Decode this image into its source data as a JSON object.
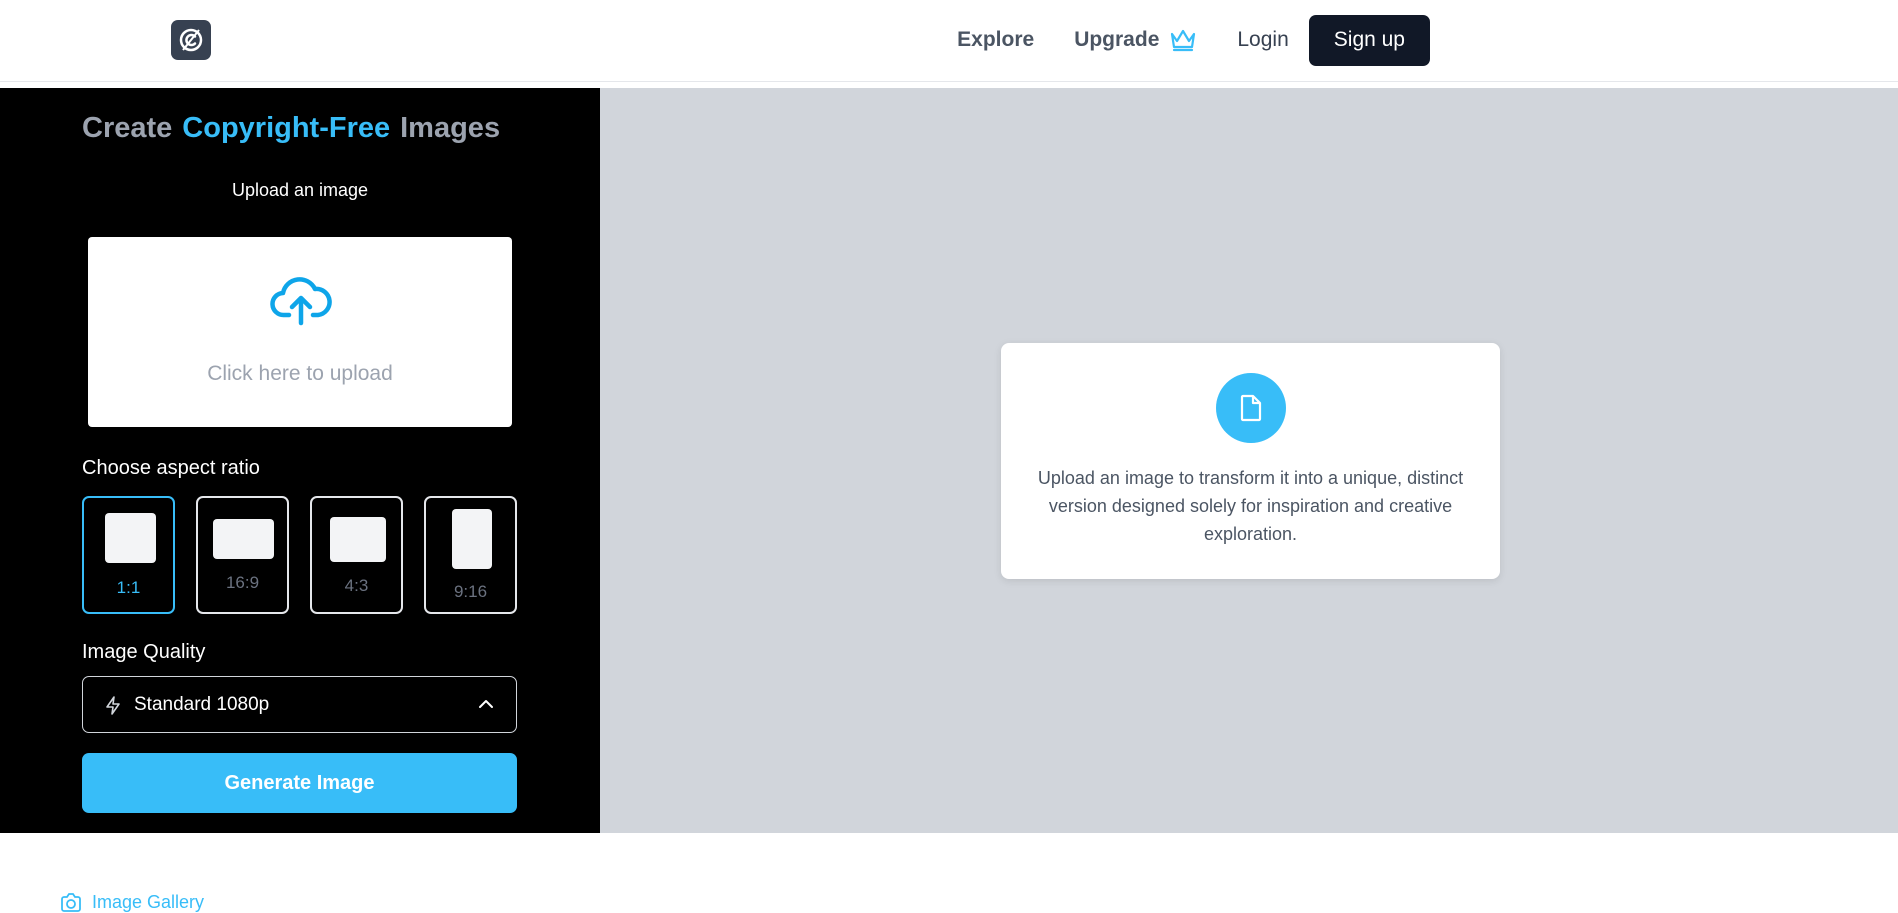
{
  "header": {
    "logo_icon": "copyright-c-icon",
    "nav": {
      "explore": "Explore",
      "upgrade": "Upgrade",
      "upgrade_icon": "crown-icon",
      "login": "Login",
      "signup": "Sign up"
    }
  },
  "sidebar": {
    "title": {
      "part1": "Create",
      "highlight": "Copyright-Free",
      "part2": "Images"
    },
    "upload_label": "Upload an image",
    "upload_box": {
      "icon": "cloud-upload-icon",
      "text": "Click here to upload"
    },
    "aspect_label": "Choose aspect ratio",
    "aspect_ratios": [
      {
        "label": "1:1",
        "selected": true
      },
      {
        "label": "16:9",
        "selected": false
      },
      {
        "label": "4:3",
        "selected": false
      },
      {
        "label": "9:16",
        "selected": false
      }
    ],
    "quality_label": "Image Quality",
    "quality_select": {
      "icon": "lightning-bolt-icon",
      "value": "Standard 1080p",
      "chevron_icon": "chevron-up-icon"
    },
    "generate_label": "Generate Image"
  },
  "preview": {
    "card_icon": "document-icon",
    "card_text": "Upload an image to transform it into a unique, distinct version designed solely for inspiration and creative exploration."
  },
  "gallery": {
    "icon": "camera-icon",
    "label": "Image Gallery"
  },
  "colors": {
    "accent": "#38bdf8",
    "dark": "#111827",
    "sidebar_bg": "#000000",
    "preview_bg": "#d1d5db"
  }
}
